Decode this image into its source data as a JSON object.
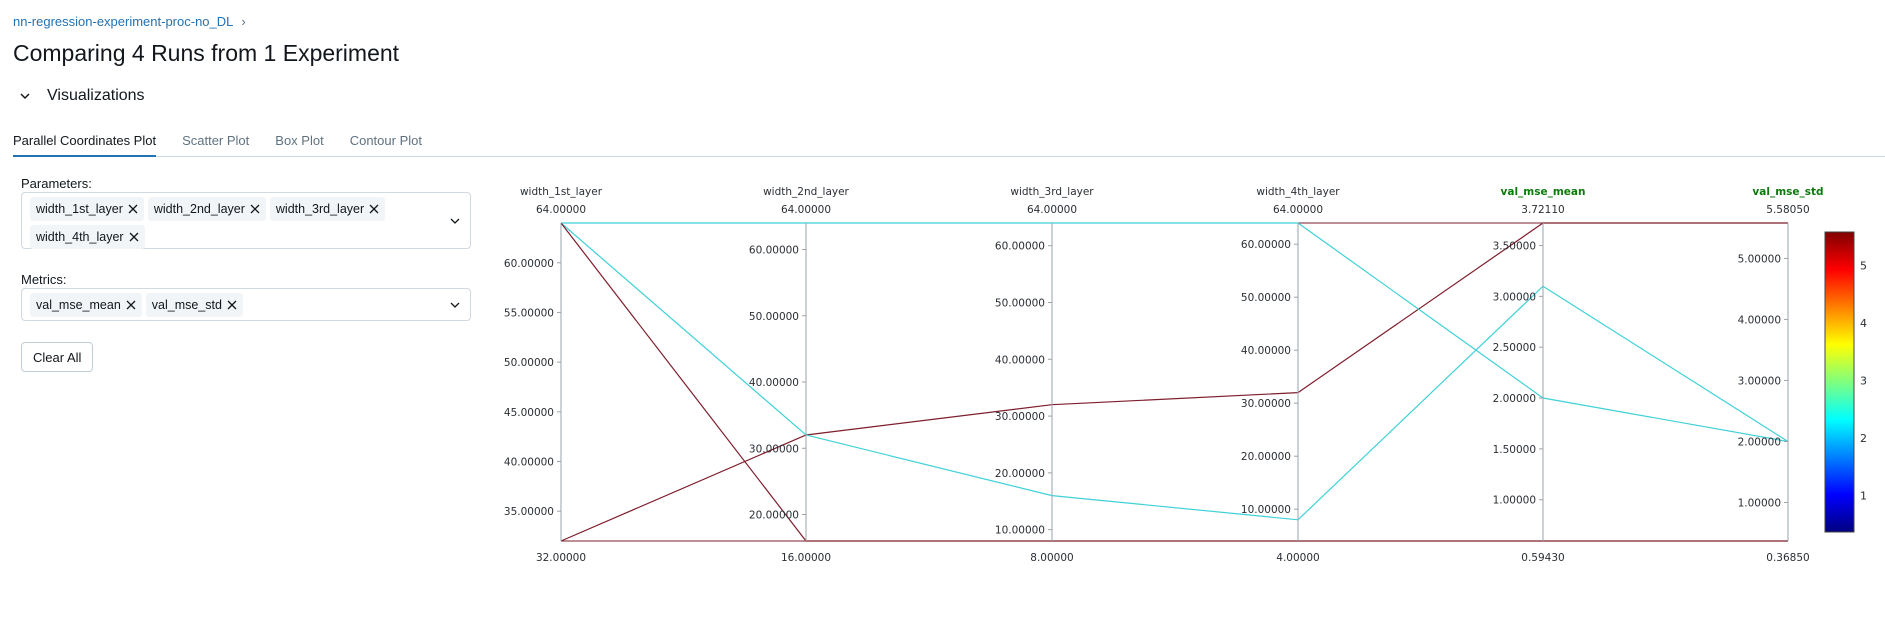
{
  "breadcrumb": {
    "experiment": "nn-regression-experiment-proc-no_DL",
    "separator": "›"
  },
  "page_title": "Comparing 4 Runs from 1 Experiment",
  "section": {
    "label": "Visualizations"
  },
  "tabs": [
    {
      "label": "Parallel Coordinates Plot",
      "active": true
    },
    {
      "label": "Scatter Plot",
      "active": false
    },
    {
      "label": "Box Plot",
      "active": false
    },
    {
      "label": "Contour Plot",
      "active": false
    }
  ],
  "params": {
    "label": "Parameters:",
    "chips": [
      "width_1st_layer",
      "width_2nd_layer",
      "width_3rd_layer",
      "width_4th_layer"
    ]
  },
  "metrics": {
    "label": "Metrics:",
    "chips": [
      "val_mse_mean",
      "val_mse_std"
    ]
  },
  "clear_all_label": "Clear All",
  "colors": {
    "accent": "#2272b4",
    "metric_title": "#0b7a0b",
    "line_high": "#7e1d2c",
    "line_mid": "#3fd1d8"
  },
  "chart_data": {
    "type": "parallel-coordinates",
    "dimensions": [
      {
        "name": "width_1st_layer",
        "is_metric": false,
        "max_label": "64.00000",
        "min_label": "32.00000",
        "range": [
          32,
          64
        ],
        "ticks": [
          "35.00000",
          "40.00000",
          "45.00000",
          "50.00000",
          "55.00000",
          "60.00000"
        ],
        "tick_values": [
          35,
          40,
          45,
          50,
          55,
          60
        ]
      },
      {
        "name": "width_2nd_layer",
        "is_metric": false,
        "max_label": "64.00000",
        "min_label": "16.00000",
        "range": [
          16,
          64
        ],
        "ticks": [
          "20.00000",
          "30.00000",
          "40.00000",
          "50.00000",
          "60.00000"
        ],
        "tick_values": [
          20,
          30,
          40,
          50,
          60
        ]
      },
      {
        "name": "width_3rd_layer",
        "is_metric": false,
        "max_label": "64.00000",
        "min_label": "8.00000",
        "range": [
          8,
          64
        ],
        "ticks": [
          "10.00000",
          "20.00000",
          "30.00000",
          "40.00000",
          "50.00000",
          "60.00000"
        ],
        "tick_values": [
          10,
          20,
          30,
          40,
          50,
          60
        ]
      },
      {
        "name": "width_4th_layer",
        "is_metric": false,
        "max_label": "64.00000",
        "min_label": "4.00000",
        "range": [
          4,
          64
        ],
        "ticks": [
          "10.00000",
          "20.00000",
          "30.00000",
          "40.00000",
          "50.00000",
          "60.00000"
        ],
        "tick_values": [
          10,
          20,
          30,
          40,
          50,
          60
        ]
      },
      {
        "name": "val_mse_mean",
        "is_metric": true,
        "max_label": "3.72110",
        "min_label": "0.59430",
        "range": [
          0.5943,
          3.7211
        ],
        "ticks": [
          "1.00000",
          "1.50000",
          "2.00000",
          "2.50000",
          "3.00000",
          "3.50000"
        ],
        "tick_values": [
          1.0,
          1.5,
          2.0,
          2.5,
          3.0,
          3.5
        ]
      },
      {
        "name": "val_mse_std",
        "is_metric": true,
        "max_label": "5.58050",
        "min_label": "0.36850",
        "range": [
          0.3685,
          5.5805
        ],
        "ticks": [
          "1.00000",
          "2.00000",
          "3.00000",
          "4.00000",
          "5.00000"
        ],
        "tick_values": [
          1,
          2,
          3,
          4,
          5
        ]
      }
    ],
    "runs": [
      {
        "values": [
          32,
          32,
          32,
          32,
          3.7211,
          5.5805
        ],
        "color_value": 5.5805
      },
      {
        "values": [
          64,
          32,
          16,
          8,
          3.1,
          2.0
        ],
        "color_value": 2.0
      },
      {
        "values": [
          64,
          64,
          64,
          64,
          2.0,
          2.0
        ],
        "color_value": 2.0
      },
      {
        "values": [
          64,
          16,
          8,
          4,
          0.5943,
          0.3685
        ],
        "color_value": 0.3685
      }
    ],
    "colorscale": {
      "ticks": [
        "1",
        "2",
        "3",
        "4",
        "5"
      ],
      "tick_values": [
        1,
        2,
        3,
        4,
        5
      ],
      "range": [
        0.3685,
        5.5805
      ]
    }
  }
}
